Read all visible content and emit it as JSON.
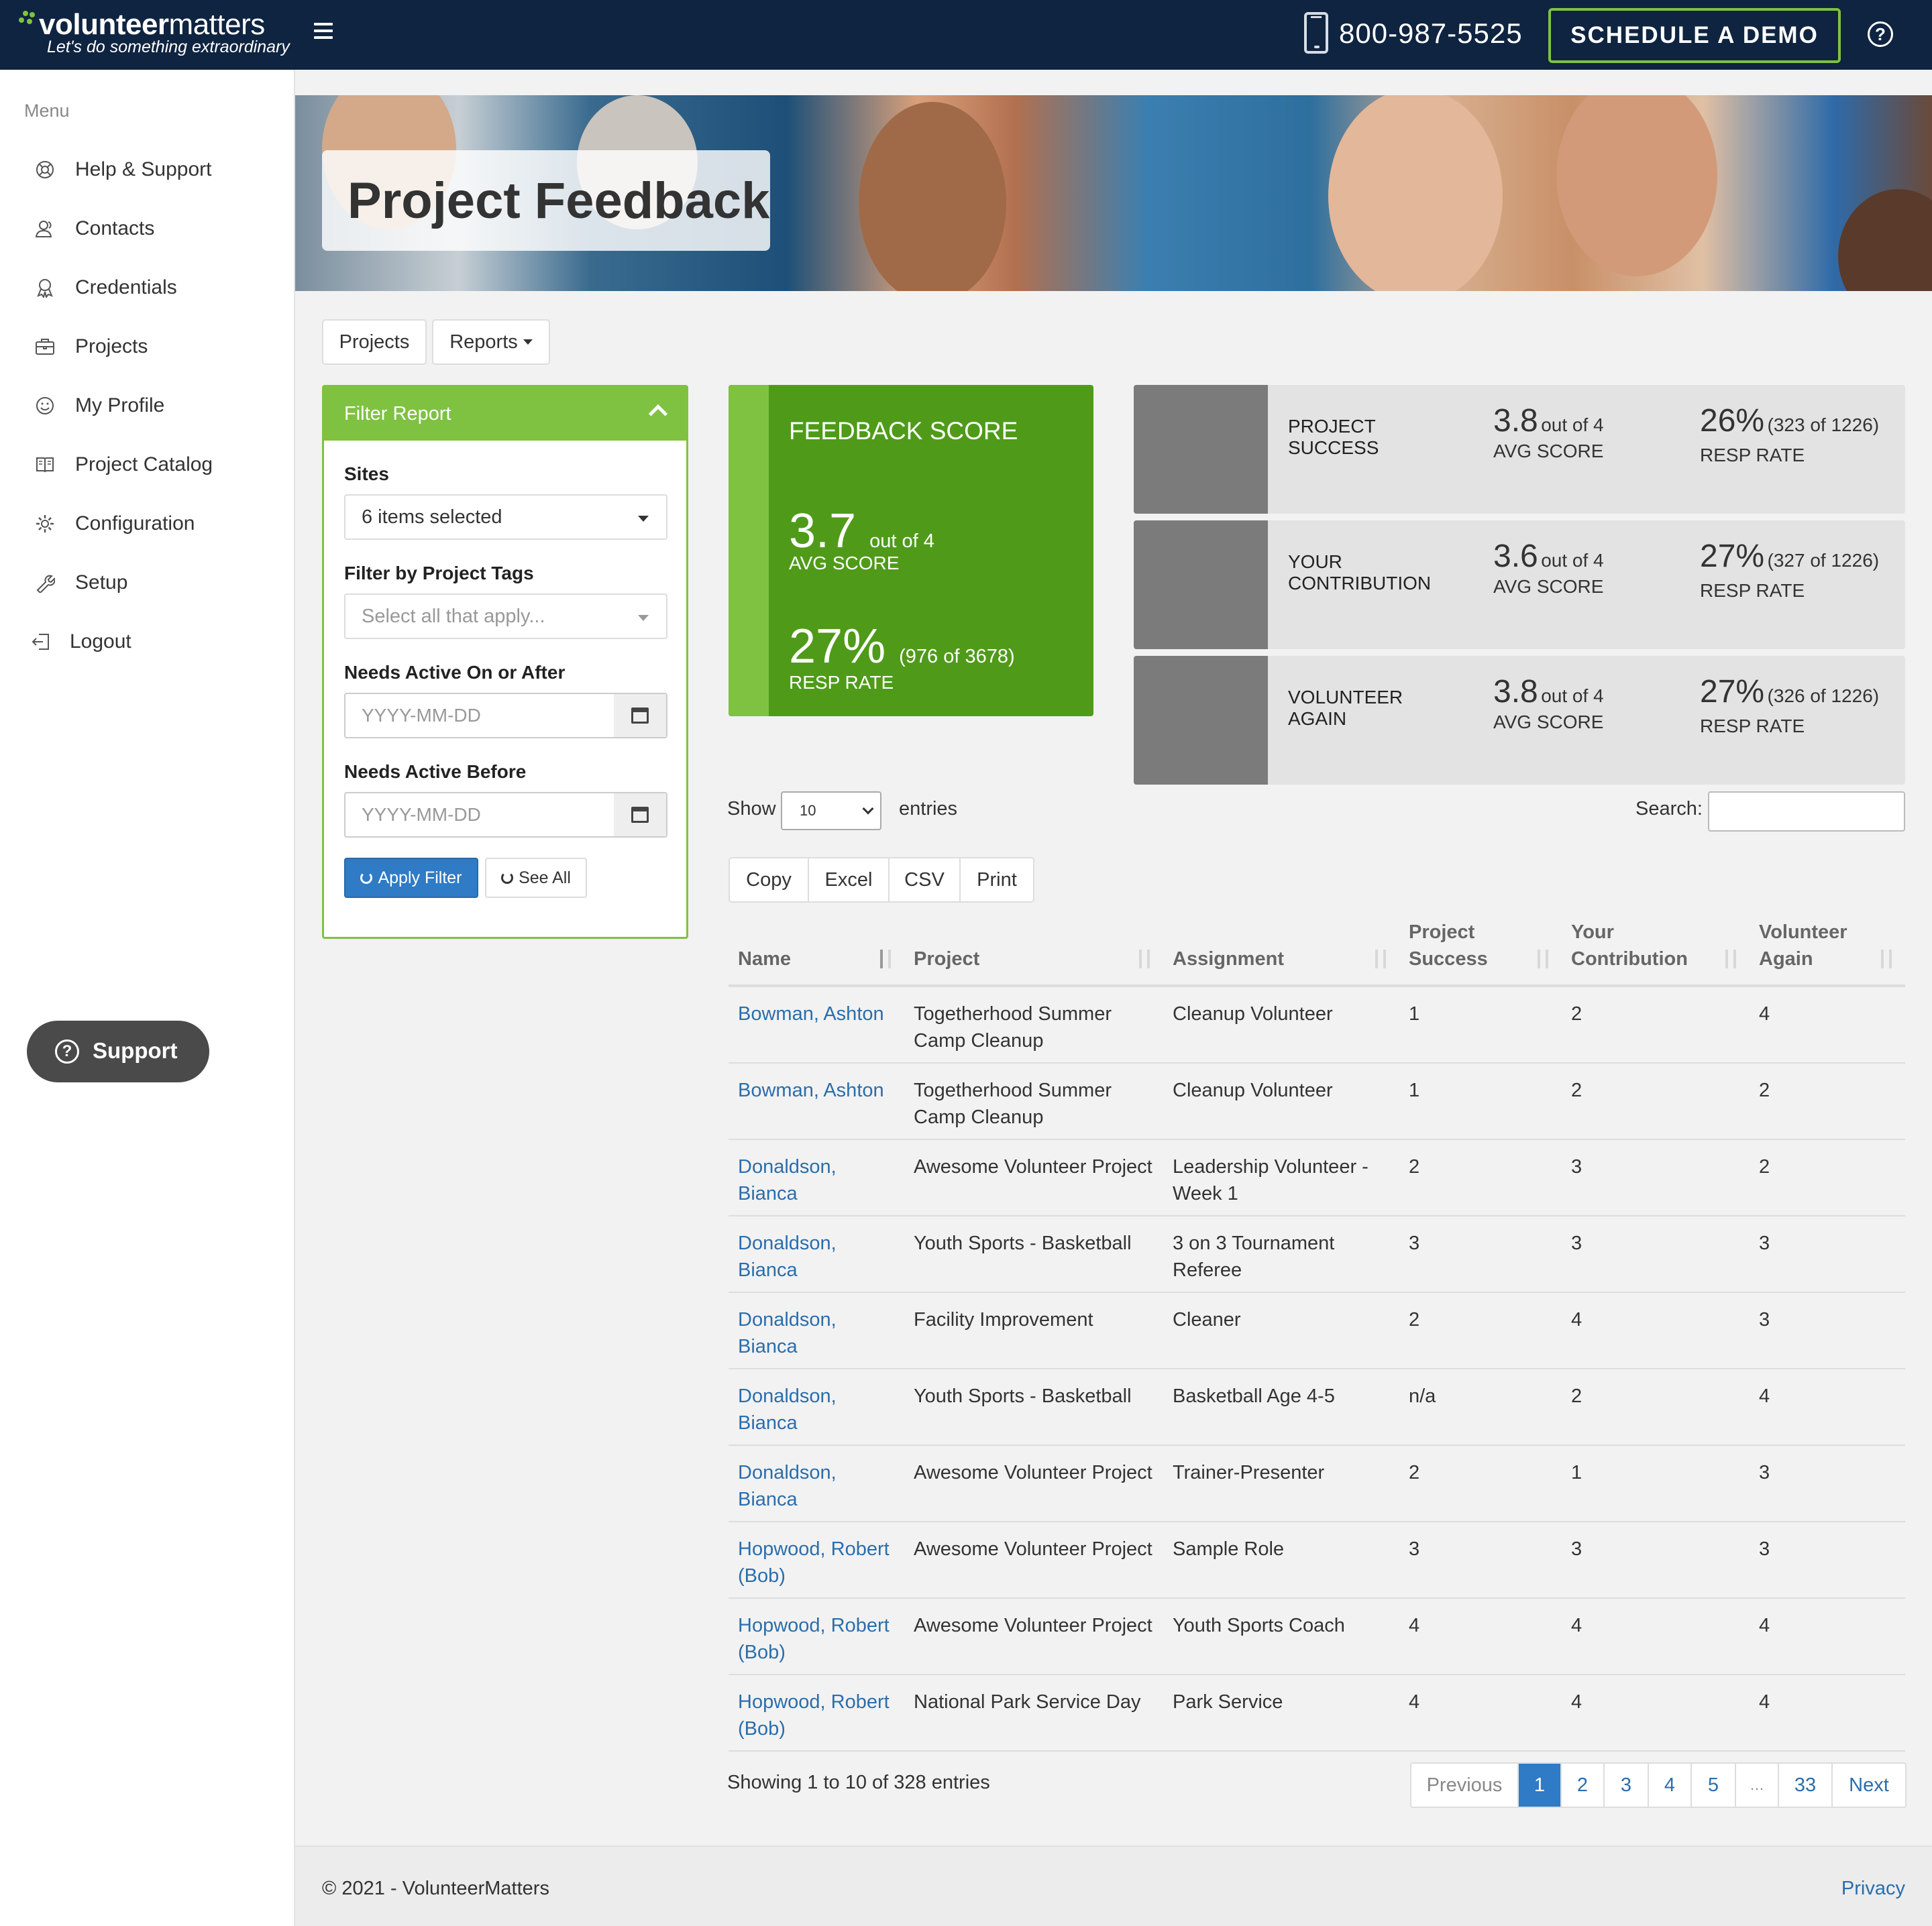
{
  "header": {
    "brand_bold": "volunteer",
    "brand_light": "matters",
    "tagline": "Let's do something extraordinary",
    "phone": "800-987-5525",
    "demo_label": "SCHEDULE A DEMO",
    "help_glyph": "?"
  },
  "sidebar": {
    "menu_label": "Menu",
    "items": [
      {
        "label": "Help & Support",
        "icon": "lifebuoy-icon"
      },
      {
        "label": "Contacts",
        "icon": "contacts-icon"
      },
      {
        "label": "Credentials",
        "icon": "award-icon"
      },
      {
        "label": "Projects",
        "icon": "briefcase-icon"
      },
      {
        "label": "My Profile",
        "icon": "smiley-icon"
      },
      {
        "label": "Project Catalog",
        "icon": "book-icon"
      },
      {
        "label": "Configuration",
        "icon": "gear-icon"
      },
      {
        "label": "Setup",
        "icon": "wrench-icon"
      },
      {
        "label": "Logout",
        "icon": "logout-icon"
      }
    ],
    "support_label": "Support",
    "support_glyph": "?"
  },
  "hero": {
    "title": "Project Feedback"
  },
  "tabs": {
    "projects": "Projects",
    "reports": "Reports"
  },
  "filter": {
    "title": "Filter Report",
    "sites_label": "Sites",
    "sites_value": "6 items selected",
    "tags_label": "Filter by Project Tags",
    "tags_placeholder": "Select all that apply...",
    "active_after_label": "Needs Active On or After",
    "active_after_placeholder": "YYYY-MM-DD",
    "active_before_label": "Needs Active Before",
    "active_before_placeholder": "YYYY-MM-DD",
    "apply_label": "Apply Filter",
    "see_all_label": "See All"
  },
  "feedback": {
    "title": "FEEDBACK SCORE",
    "avg_value": "3.7",
    "avg_suffix": "out of 4",
    "avg_caption": "AVG SCORE",
    "rate_value": "27%",
    "rate_suffix": "(976 of 3678)",
    "rate_caption": "RESP RATE"
  },
  "metrics": [
    {
      "name": "PROJECT SUCCESS",
      "avg": "3.8",
      "avg_suffix": "out of 4",
      "avg_caption": "AVG SCORE",
      "rate": "26%",
      "rate_suffix": "(323 of 1226)",
      "rate_caption": "RESP RATE"
    },
    {
      "name": "YOUR CONTRIBUTION",
      "avg": "3.6",
      "avg_suffix": "out of 4",
      "avg_caption": "AVG SCORE",
      "rate": "27%",
      "rate_suffix": "(327 of 1226)",
      "rate_caption": "RESP RATE"
    },
    {
      "name": "VOLUNTEER AGAIN",
      "avg": "3.8",
      "avg_suffix": "out of 4",
      "avg_caption": "AVG SCORE",
      "rate": "27%",
      "rate_suffix": "(326 of 1226)",
      "rate_caption": "RESP RATE"
    }
  ],
  "table_controls": {
    "show_label": "Show",
    "page_size": "10",
    "entries_label": "entries",
    "search_label": "Search:",
    "export_buttons": [
      "Copy",
      "Excel",
      "CSV",
      "Print"
    ]
  },
  "table": {
    "columns": [
      "Name",
      "Project",
      "Assignment",
      "Project Success",
      "Your Contribution",
      "Volunteer Again"
    ],
    "rows": [
      [
        "Bowman, Ashton",
        "Togetherhood Summer Camp Cleanup",
        "Cleanup Volunteer",
        "1",
        "2",
        "4"
      ],
      [
        "Bowman, Ashton",
        "Togetherhood Summer Camp Cleanup",
        "Cleanup Volunteer",
        "1",
        "2",
        "2"
      ],
      [
        "Donaldson, Bianca",
        "Awesome Volunteer Project",
        "Leadership Volunteer - Week 1",
        "2",
        "3",
        "2"
      ],
      [
        "Donaldson, Bianca",
        "Youth Sports - Basketball",
        "3 on 3 Tournament Referee",
        "3",
        "3",
        "3"
      ],
      [
        "Donaldson, Bianca",
        "Facility Improvement",
        "Cleaner",
        "2",
        "4",
        "3"
      ],
      [
        "Donaldson, Bianca",
        "Youth Sports - Basketball",
        "Basketball Age 4-5",
        "n/a",
        "2",
        "4"
      ],
      [
        "Donaldson, Bianca",
        "Awesome Volunteer Project",
        "Trainer-Presenter",
        "2",
        "1",
        "3"
      ],
      [
        "Hopwood, Robert (Bob)",
        "Awesome Volunteer Project",
        "Sample Role",
        "3",
        "3",
        "3"
      ],
      [
        "Hopwood, Robert (Bob)",
        "Awesome Volunteer Project",
        "Youth Sports Coach",
        "4",
        "4",
        "4"
      ],
      [
        "Hopwood, Robert (Bob)",
        "National Park Service Day",
        "Park Service",
        "4",
        "4",
        "4"
      ]
    ]
  },
  "pagination": {
    "summary": "Showing 1 to 10 of 328 entries",
    "previous": "Previous",
    "pages": [
      "1",
      "2",
      "3",
      "4",
      "5",
      "…",
      "33"
    ],
    "active_page": "1",
    "next": "Next"
  },
  "footer": {
    "copyright": "© 2021 - VolunteerMatters",
    "privacy": "Privacy"
  },
  "colors": {
    "navy": "#0f2440",
    "green": "#7fc241",
    "dark_green": "#4f9b19",
    "link_blue": "#2a6ead",
    "primary_blue": "#2f7bc6"
  }
}
